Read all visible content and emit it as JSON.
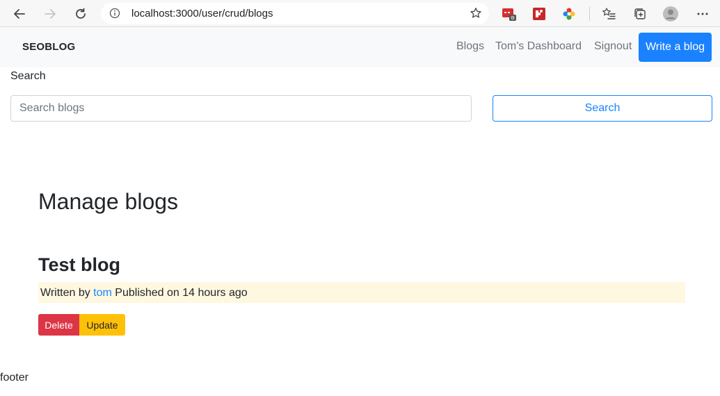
{
  "browser": {
    "url": "localhost:3000/user/crud/blogs"
  },
  "navbar": {
    "brand": "SEOBLOG",
    "links": [
      "Blogs",
      "Tom's Dashboard",
      "Signout"
    ],
    "write_label": "Write a blog"
  },
  "search": {
    "label": "Search",
    "placeholder": "Search blogs",
    "button_label": "Search"
  },
  "manage": {
    "title": "Manage blogs",
    "blog": {
      "title": "Test blog",
      "written_by": "Written by ",
      "author": "tom",
      "published": " Published on 14 hours ago",
      "delete_label": "Delete",
      "update_label": "Update"
    }
  },
  "footer": "footer",
  "colors": {
    "primary": "#1a82ff",
    "danger": "#dc3545",
    "warning": "#ffc107",
    "meta_bg": "#fff8e1"
  }
}
